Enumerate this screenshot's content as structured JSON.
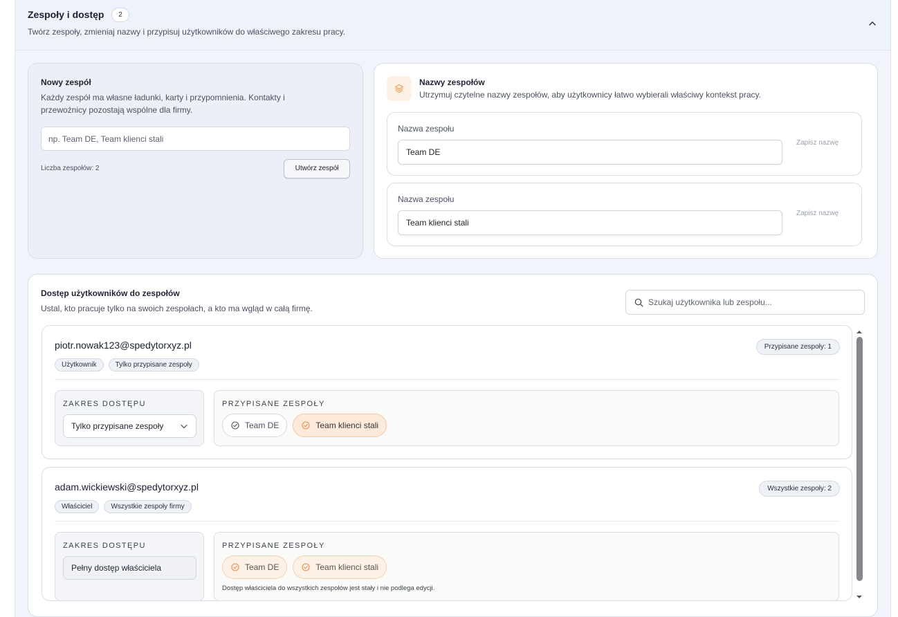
{
  "header": {
    "title": "Zespoły i dostęp",
    "count": "2",
    "description": "Twórz zespoły, zmieniaj nazwy i przypisuj użytkowników do właściwego zakresu pracy."
  },
  "new_team": {
    "title": "Nowy zespół",
    "description": "Każdy zespół ma własne ładunki, karty i przypomnienia. Kontakty i przewoźnicy pozostają wspólne dla firmy.",
    "placeholder": "np. Team DE, Team klienci stali",
    "count_label": "Liczba zespołów: 2",
    "create_label": "Utwórz zespół"
  },
  "team_names": {
    "title": "Nazwy zespołów",
    "description": "Utrzymuj czytelne nazwy zespołów, aby użytkownicy łatwo wybierali właściwy kontekst pracy.",
    "rows": [
      {
        "label": "Nazwa zespołu",
        "value": "Team DE",
        "save": "Zapisz nazwę"
      },
      {
        "label": "Nazwa zespołu",
        "value": "Team klienci stali",
        "save": "Zapisz nazwę"
      }
    ]
  },
  "access": {
    "title": "Dostęp użytkowników do zespołów",
    "description": "Ustal, kto pracuje tylko na swoich zespołach, a kto ma wgląd w całą firmę.",
    "search_placeholder": "Szukaj użytkownika lub zespołu...",
    "scope_caption": "ZAKRES DOSTĘPU",
    "assigned_caption": "PRZYPISANE ZESPOŁY",
    "users": [
      {
        "email": "piotr.nowak123@spedytorxyz.pl",
        "role": "Użytkownik",
        "mode": "Tylko przypisane zespoły",
        "badge": "Przypisane zespoły: 1",
        "scope_value": "Tylko przypisane zespoły",
        "teams": [
          {
            "name": "Team DE",
            "selected": false
          },
          {
            "name": "Team klienci stali",
            "selected": true
          }
        ]
      },
      {
        "email": "adam.wickiewski@spedytorxyz.pl",
        "role": "Właściciel",
        "mode": "Wszystkie zespoły firmy",
        "badge": "Wszystkie zespoły: 2",
        "scope_value": "Pełny dostęp właściciela",
        "teams": [
          {
            "name": "Team DE",
            "selected": true
          },
          {
            "name": "Team klienci stali",
            "selected": true
          }
        ],
        "note": "Dostęp właściciela do wszystkich zespołów jest stały i nie podlega edycji."
      }
    ]
  },
  "colors": {
    "accent": "#f0a060",
    "chip_selected_bg": "#fdeadb",
    "scrollbar": "#85878c"
  }
}
